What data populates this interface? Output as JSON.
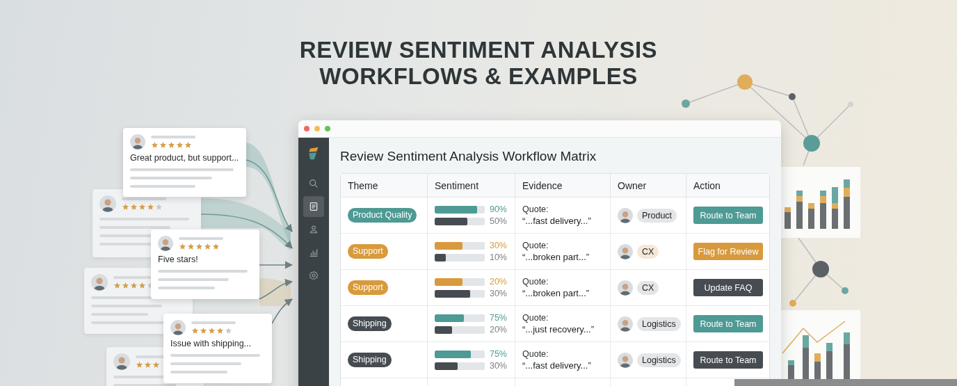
{
  "headline": [
    "REVIEW SENTIMENT ANALYSIS",
    "WORKFLOWS & EXAMPLES"
  ],
  "reviews": [
    {
      "kind": "front",
      "stars": 5,
      "text": "Great product, but support..."
    },
    {
      "kind": "back",
      "stars": 4
    },
    {
      "kind": "front",
      "stars": 5,
      "text": "Five stars!"
    },
    {
      "kind": "back",
      "stars": 4
    },
    {
      "kind": "front",
      "stars": 4,
      "text": "Issue with shipping..."
    },
    {
      "kind": "back",
      "stars": 3
    }
  ],
  "window": {
    "title": "Review Sentiment Analysis Workflow Matrix"
  },
  "nav": [
    {
      "kind": "search",
      "selected": false
    },
    {
      "kind": "document",
      "selected": true
    },
    {
      "kind": "people",
      "selected": false
    },
    {
      "kind": "chart",
      "selected": false
    },
    {
      "kind": "settings",
      "selected": false
    }
  ],
  "table": {
    "columns": [
      "Theme",
      "Sentiment",
      "Evidence",
      "Owner",
      "Action"
    ],
    "rows": [
      {
        "theme": {
          "label": "Product Quality",
          "color": "#4e9a94"
        },
        "sentiment": [
          {
            "level": 0.85,
            "reading": "90%",
            "color": "#4e9a94"
          },
          {
            "level": 0.65,
            "reading": "50%",
            "color": "#464c51"
          }
        ],
        "evidence": {
          "label": "Quote:",
          "quote": "“...fast delivery...”"
        },
        "owner": {
          "label": "Product",
          "color": "#e3e5e7"
        },
        "action": {
          "label": "Route to Team",
          "color": "#4e9a94"
        }
      },
      {
        "theme": {
          "label": "Support",
          "color": "#d89a3c"
        },
        "sentiment": [
          {
            "level": 0.56,
            "reading": "30%",
            "color": "#d89a3c"
          },
          {
            "level": 0.22,
            "reading": "10%",
            "color": "#464c51"
          }
        ],
        "evidence": {
          "label": "Quote:",
          "quote": "“...broken part...”"
        },
        "owner": {
          "label": "CX",
          "color": "#f6e8d6"
        },
        "action": {
          "label": "Flag for Review",
          "color": "#d89a3c"
        }
      },
      {
        "theme": {
          "label": "Support",
          "color": "#d89a3c"
        },
        "sentiment": [
          {
            "level": 0.56,
            "reading": "20%",
            "color": "#d89a3c"
          },
          {
            "level": 0.71,
            "reading": "30%",
            "color": "#464c51"
          }
        ],
        "evidence": {
          "label": "Quote:",
          "quote": "“...broken part...”"
        },
        "owner": {
          "label": "CX",
          "color": "#e3e5e7"
        },
        "action": {
          "label": "Update FAQ",
          "color": "#464c51"
        }
      },
      {
        "theme": {
          "label": "Shipping",
          "color": "#464c51"
        },
        "sentiment": [
          {
            "level": 0.58,
            "reading": "75%",
            "color": "#4e9a94"
          },
          {
            "level": 0.35,
            "reading": "20%",
            "color": "#464c51"
          }
        ],
        "evidence": {
          "label": "Quote:",
          "quote": "“...just recovery...”"
        },
        "owner": {
          "label": "Logistics",
          "color": "#e3e5e7"
        },
        "action": {
          "label": "Route to Team",
          "color": "#4e9a94"
        }
      },
      {
        "theme": {
          "label": "Shipping",
          "color": "#464c51"
        },
        "sentiment": [
          {
            "level": 0.72,
            "reading": "75%",
            "color": "#4e9a94"
          },
          {
            "level": 0.46,
            "reading": "30%",
            "color": "#464c51"
          }
        ],
        "evidence": {
          "label": "Quote:",
          "quote": "“...fast delivery...”"
        },
        "owner": {
          "label": "Logistics",
          "color": "#e3e5e7"
        },
        "action": {
          "label": "Route to Team",
          "color": "#464c51"
        }
      }
    ]
  }
}
